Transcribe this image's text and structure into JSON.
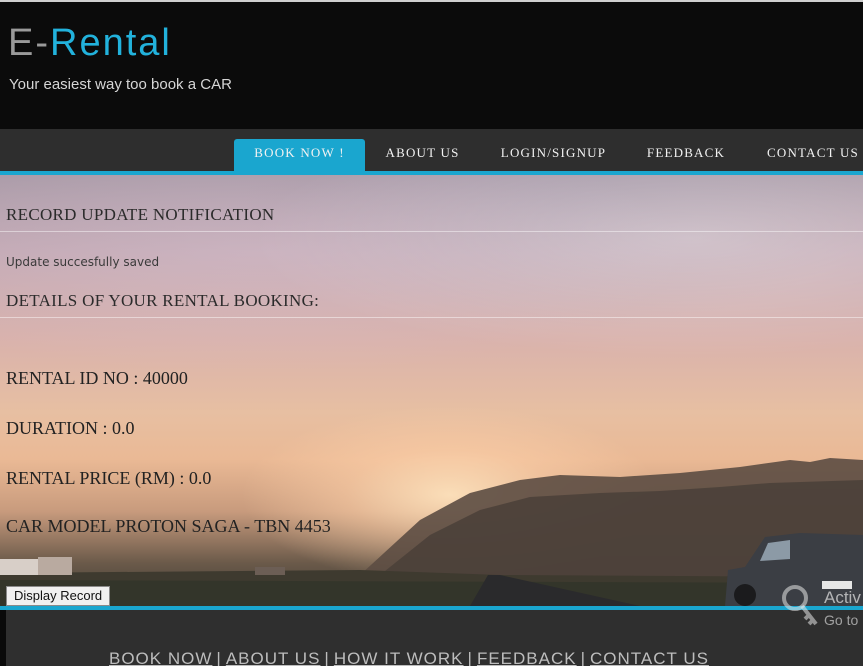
{
  "header": {
    "logo_prefix": "E-",
    "logo_main": "Rental",
    "tagline": "Your easiest way too book a CAR"
  },
  "nav": {
    "items": [
      {
        "label": "BOOK NOW !",
        "active": true
      },
      {
        "label": "ABOUT US"
      },
      {
        "label": "LOGIN/SIGNUP"
      },
      {
        "label": "FEEDBACK"
      },
      {
        "label": "CONTACT US"
      }
    ]
  },
  "main": {
    "notification_heading": "RECORD UPDATE NOTIFICATION",
    "notification_message": "Update succesfully saved",
    "details_heading": "DETAILS OF YOUR RENTAL BOOKING:",
    "rental_id": "RENTAL ID NO : 40000",
    "duration": "DURATION : 0.0",
    "rental_price": "RENTAL PRICE (RM) : 0.0",
    "car_model": "CAR MODEL PROTON SAGA - TBN 4453",
    "display_button": "Display Record"
  },
  "footer": {
    "links": [
      "BOOK NOW",
      "ABOUT US",
      "HOW IT WORK",
      "FEEDBACK",
      "CONTACT US"
    ],
    "separator": "|"
  },
  "watermark": {
    "line1": "Activ",
    "line2": "Go to"
  },
  "colors": {
    "accent": "#1aa6cf",
    "header_bg": "#0b0b0b",
    "nav_bg": "#2e2e2e",
    "footer_bg": "#2f2f2f"
  }
}
